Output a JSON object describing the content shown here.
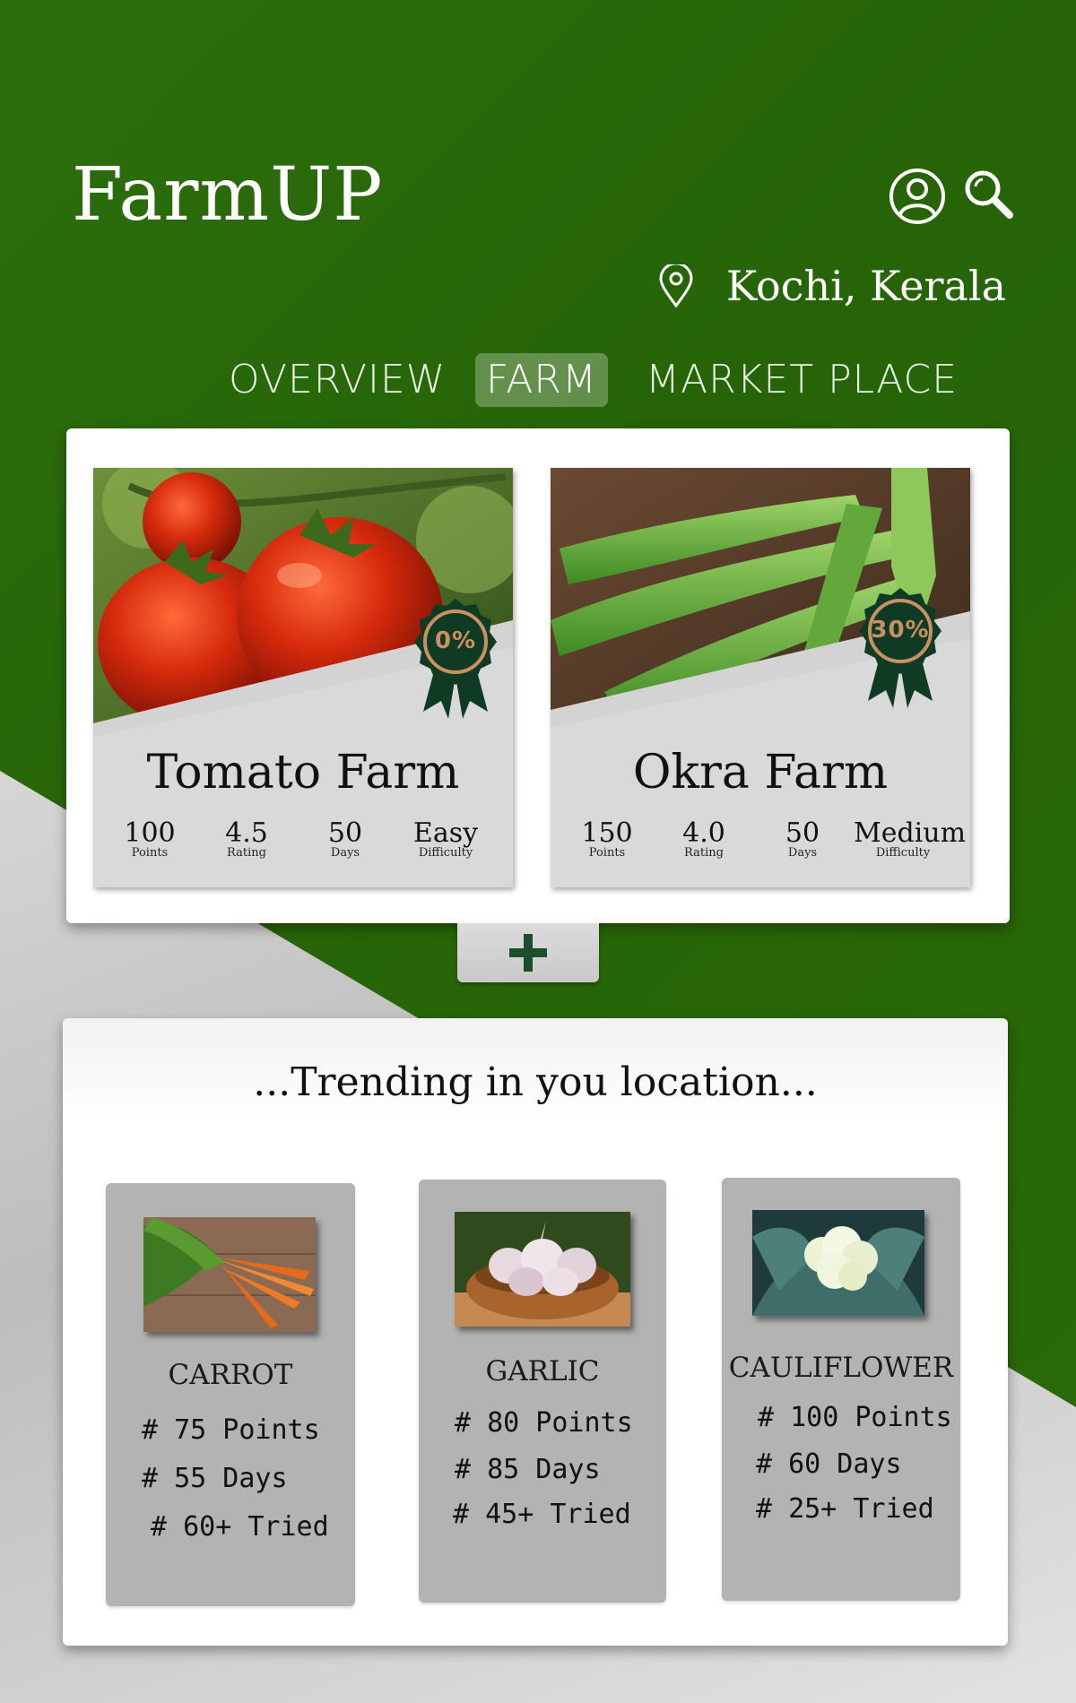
{
  "app": {
    "title": "FarmUP"
  },
  "header": {
    "location": "Kochi, Kerala"
  },
  "tabs": [
    {
      "label": "OVERVIEW",
      "active": false
    },
    {
      "label": "FARM",
      "active": true
    },
    {
      "label": "MARKET PLACE",
      "active": false
    }
  ],
  "farms": [
    {
      "name": "Tomato Farm",
      "progress": "0%",
      "stats": [
        {
          "value": "100",
          "label": "Points"
        },
        {
          "value": "4.5",
          "label": "Rating"
        },
        {
          "value": "50",
          "label": "Days"
        },
        {
          "value": "Easy",
          "label": "Difficulty"
        }
      ]
    },
    {
      "name": "Okra Farm",
      "progress": "30%",
      "stats": [
        {
          "value": "150",
          "label": "Points"
        },
        {
          "value": "4.0",
          "label": "Rating"
        },
        {
          "value": "50",
          "label": "Days"
        },
        {
          "value": "Medium",
          "label": "Difficulty"
        }
      ]
    }
  ],
  "add_button": {
    "icon": "plus-icon"
  },
  "trending": {
    "title": "...Trending in you location...",
    "items": [
      {
        "name": "CARROT",
        "lines": [
          "# 75 Points",
          "# 55 Days",
          "# 60+ Tried"
        ]
      },
      {
        "name": "GARLIC",
        "lines": [
          "# 80 Points",
          "# 85 Days",
          "# 45+ Tried"
        ]
      },
      {
        "name": "CAULIFLOWER",
        "lines": [
          "# 100 Points",
          "# 60 Days",
          "# 25+ Tried"
        ]
      }
    ]
  },
  "colors": {
    "brand_green": "#276607",
    "badge_green": "#0f3b24",
    "badge_ring": "#c99061",
    "card_grey": "#b3b3b3"
  }
}
